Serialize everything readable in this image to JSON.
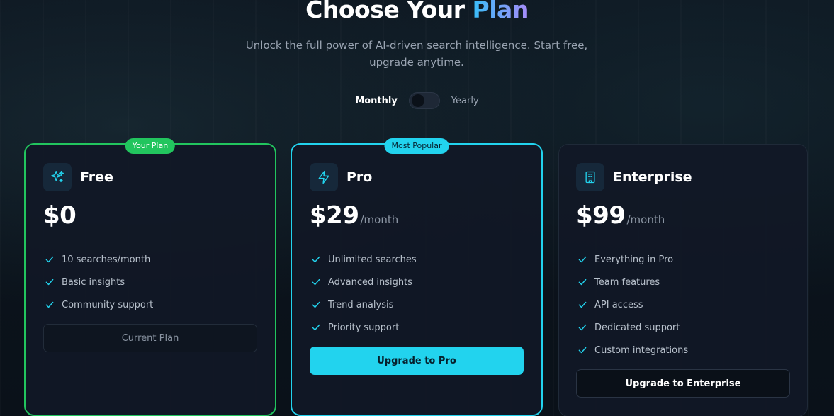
{
  "header": {
    "title_main": "Choose Your",
    "title_accent": "Plan",
    "subtitle": "Unlock the full power of AI-driven search intelligence. Start free, upgrade anytime."
  },
  "billing_toggle": {
    "monthly_label": "Monthly",
    "yearly_label": "Yearly",
    "selected": "Monthly"
  },
  "plans": {
    "free": {
      "badge": "Your Plan",
      "icon": "sparkles-icon",
      "name": "Free",
      "price": "$0",
      "period": "",
      "features": [
        "10 searches/month",
        "Basic insights",
        "Community support"
      ],
      "button": "Current Plan"
    },
    "pro": {
      "badge": "Most Popular",
      "icon": "lightning-icon",
      "name": "Pro",
      "price": "$29",
      "period": "/month",
      "features": [
        "Unlimited searches",
        "Advanced insights",
        "Trend analysis",
        "Priority support"
      ],
      "button": "Upgrade to Pro"
    },
    "enterprise": {
      "icon": "building-icon",
      "name": "Enterprise",
      "price": "$99",
      "period": "/month",
      "features": [
        "Everything in Pro",
        "Team features",
        "API access",
        "Dedicated support",
        "Custom integrations"
      ],
      "button": "Upgrade to Enterprise"
    }
  },
  "colors": {
    "free_border": "#22c55e",
    "pro_accent": "#22d3ee",
    "check": "#22d3ee",
    "background": "#0b131c"
  }
}
